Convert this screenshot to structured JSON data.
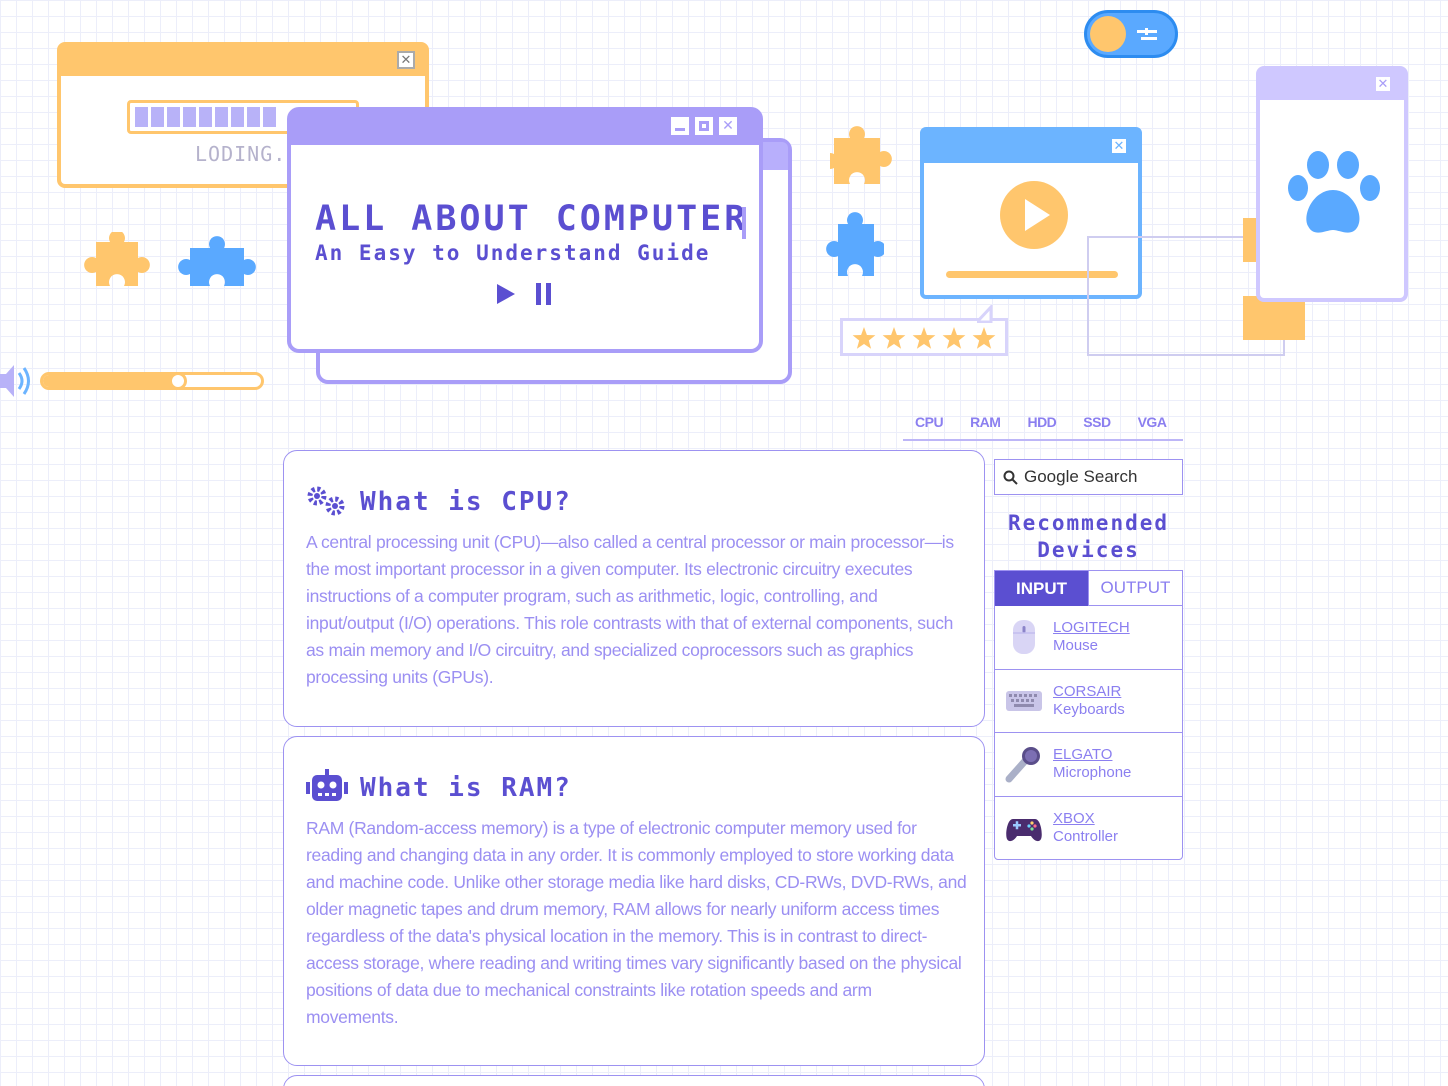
{
  "header": {
    "title": "ALL ABOUT COMPUTER",
    "subtitle": "An Easy to Understand Guide",
    "loading_text": "LODING..."
  },
  "volume": {
    "level_percent": 62
  },
  "rating": {
    "stars": 5
  },
  "nav": {
    "items": [
      "CPU",
      "RAM",
      "HDD",
      "SSD",
      "VGA"
    ]
  },
  "sections": [
    {
      "title": "What is CPU?",
      "icon": "gears-icon",
      "body": "A central processing unit (CPU)—also called a central processor or main processor—is the most important processor in a given computer. Its electronic circuitry executes instructions of a computer program, such as arithmetic, logic, controlling, and input/output (I/O) operations. This role contrasts with that of external components, such as main memory and I/O circuitry, and specialized coprocessors such as graphics processing units (GPUs)."
    },
    {
      "title": "What is RAM?",
      "icon": "robot-icon",
      "body": "RAM (Random-access memory) is a type of electronic computer memory used for reading and changing data in any order. It is commonly employed to store working data and machine code. Unlike other storage media like hard disks, CD-RWs, DVD-RWs, and older magnetic tapes and drum memory, RAM allows for nearly uniform access times regardless of the data's physical location in the memory. This is in contrast to direct-access storage, where reading and writing times vary significantly based on the physical positions of data due to mechanical constraints like rotation speeds and arm movements."
    }
  ],
  "sidebar": {
    "search_placeholder": "Google Search",
    "heading": "Recommended Devices",
    "tabs": [
      "INPUT",
      "OUTPUT"
    ],
    "active_tab": "INPUT",
    "devices": [
      {
        "brand": "LOGITECH",
        "type": "Mouse",
        "icon": "mouse-icon"
      },
      {
        "brand": "CORSAIR",
        "type": "Keyboards",
        "icon": "keyboard-icon"
      },
      {
        "brand": "ELGATO",
        "type": "Microphone",
        "icon": "microphone-icon"
      },
      {
        "brand": "XBOX",
        "type": "Controller",
        "icon": "gamepad-icon"
      }
    ]
  },
  "colors": {
    "primary": "#5b4fd1",
    "lavender": "#a99df8",
    "yellow": "#ffc66d",
    "blue": "#6cb4ff",
    "text": "#9b8ff2"
  }
}
